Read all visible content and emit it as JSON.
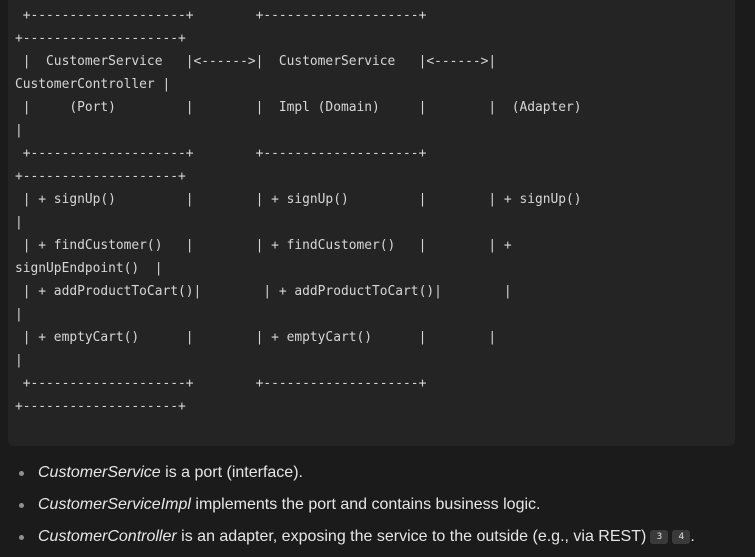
{
  "code_block": {
    "lines": [
      " +--------------------+        +--------------------+",
      "+--------------------+",
      " |  CustomerService   |<------>|  CustomerService   |<------>|",
      "CustomerController |",
      " |     (Port)         |        |  Impl (Domain)     |        |  (Adapter)",
      "|",
      " +--------------------+        +--------------------+",
      "+--------------------+",
      " | + signUp()         |        | + signUp()         |        | + signUp()",
      "|",
      " | + findCustomer()   |        | + findCustomer()   |        | +",
      "signUpEndpoint()  |",
      " | + addProductToCart()|        | + addProductToCart()|        |",
      "|",
      " | + emptyCart()      |        | + emptyCart()      |        |",
      "|",
      " +--------------------+        +--------------------+",
      "+--------------------+"
    ]
  },
  "bullets": [
    {
      "term": "CustomerService",
      "rest": " is a port (interface).",
      "badges": []
    },
    {
      "term": "CustomerServiceImpl",
      "rest": " implements the port and contains business logic.",
      "badges": []
    },
    {
      "term": "CustomerController",
      "rest": " is an adapter, exposing the service to the outside (e.g., via REST)",
      "badges": [
        "3",
        "4"
      ],
      "trailing": "."
    }
  ]
}
